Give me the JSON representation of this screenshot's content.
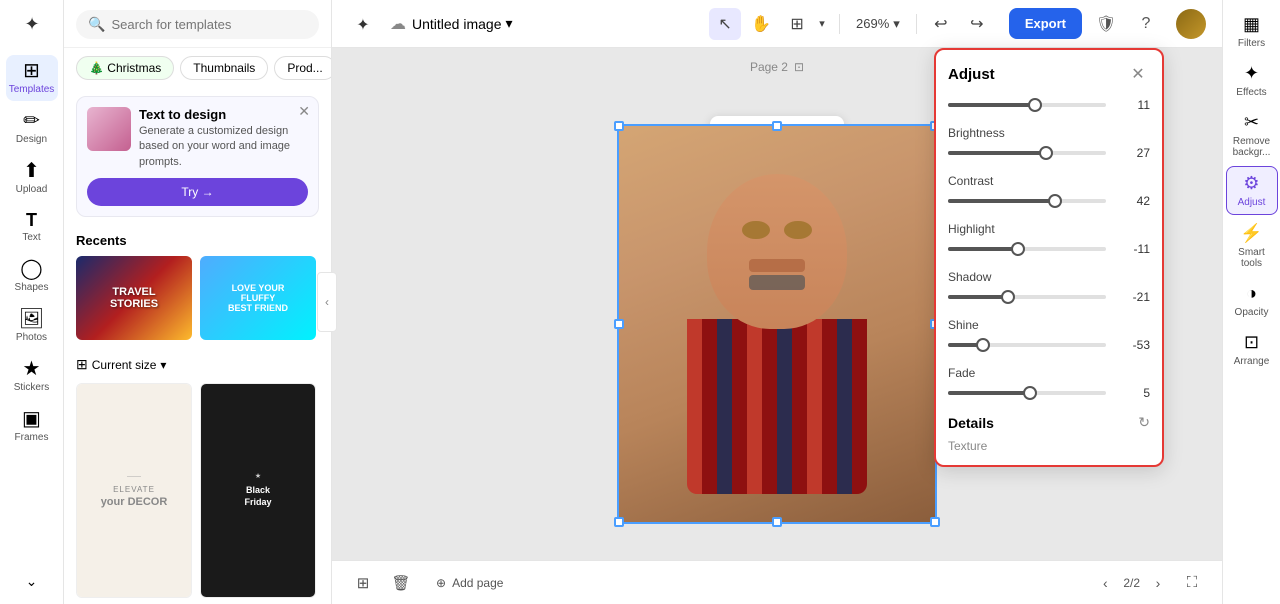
{
  "app": {
    "logo": "✦",
    "title": "Untitled image",
    "title_icon": "▾"
  },
  "toolbar": {
    "select_tool": "↖",
    "hand_tool": "✋",
    "frame_tool": "⊞",
    "frame_dropdown": "▾",
    "zoom_level": "269%",
    "zoom_dropdown": "▾",
    "undo": "↩",
    "redo": "↪",
    "export_label": "Export",
    "shield_icon": "🛡",
    "help_icon": "?"
  },
  "sidebar": {
    "items": [
      {
        "id": "templates",
        "label": "Templates",
        "icon": "⊞",
        "active": true
      },
      {
        "id": "design",
        "label": "Design",
        "icon": "✏"
      },
      {
        "id": "upload",
        "label": "Upload",
        "icon": "⬆"
      },
      {
        "id": "text",
        "label": "Text",
        "icon": "T"
      },
      {
        "id": "shapes",
        "label": "Shapes",
        "icon": "◯"
      },
      {
        "id": "photos",
        "label": "Photos",
        "icon": "🖼"
      },
      {
        "id": "stickers",
        "label": "Stickers",
        "icon": "★"
      },
      {
        "id": "frames",
        "label": "Frames",
        "icon": "▣"
      }
    ]
  },
  "left_panel": {
    "search_placeholder": "Search for templates",
    "tags": [
      {
        "label": "🎄 Christmas",
        "active": true
      },
      {
        "label": "Thumbnails"
      },
      {
        "label": "Prod..."
      }
    ],
    "promo": {
      "title": "Text to design",
      "description": "Generate a customized design based on your word and image prompts.",
      "btn_label": "Try →"
    },
    "recents_title": "Recents",
    "size_label": "Current size",
    "templates": [
      {
        "label": "ELEVATE your DECOR"
      },
      {
        "label": "Black Friday"
      }
    ]
  },
  "canvas": {
    "page_label": "Page 2",
    "toolbar_icons": [
      "crop",
      "grid",
      "copy",
      "more"
    ],
    "toolbar_symbols": [
      "⊡",
      "⊞",
      "⧉",
      "•••"
    ]
  },
  "bottom_bar": {
    "delete_icon": "🗑",
    "add_page_label": "Add page",
    "page_current": "2/2",
    "nav_prev": "‹",
    "nav_next": "›"
  },
  "adjust_panel": {
    "title": "Adjust",
    "close": "✕",
    "sliders": [
      {
        "label": "",
        "value": 11,
        "percent": 55,
        "thumb_percent": 55
      },
      {
        "label": "Brightness",
        "value": 27,
        "percent": 62,
        "thumb_percent": 62
      },
      {
        "label": "Contrast",
        "value": 42,
        "percent": 68,
        "thumb_percent": 68
      },
      {
        "label": "Highlight",
        "value": -11,
        "percent": 44,
        "thumb_percent": 44
      },
      {
        "label": "Shadow",
        "value": -21,
        "percent": 38,
        "thumb_percent": 38
      },
      {
        "label": "Shine",
        "value": -53,
        "percent": 22,
        "thumb_percent": 22
      },
      {
        "label": "Fade",
        "value": 5,
        "percent": 52,
        "thumb_percent": 52
      }
    ],
    "details_title": "Details",
    "details_refresh": "↻",
    "texture_label": "Texture"
  },
  "right_panel": {
    "items": [
      {
        "id": "filters",
        "label": "Filters",
        "icon": "▦"
      },
      {
        "id": "effects",
        "label": "Effects",
        "icon": "✦"
      },
      {
        "id": "remove-bg",
        "label": "Remove backgr...",
        "icon": "✂"
      },
      {
        "id": "adjust",
        "label": "Adjust",
        "icon": "⚙",
        "active": true
      },
      {
        "id": "smart-tools",
        "label": "Smart tools",
        "icon": "⚡"
      },
      {
        "id": "opacity",
        "label": "Opacity",
        "icon": "◑"
      },
      {
        "id": "arrange",
        "label": "Arrange",
        "icon": "⊡"
      }
    ]
  }
}
